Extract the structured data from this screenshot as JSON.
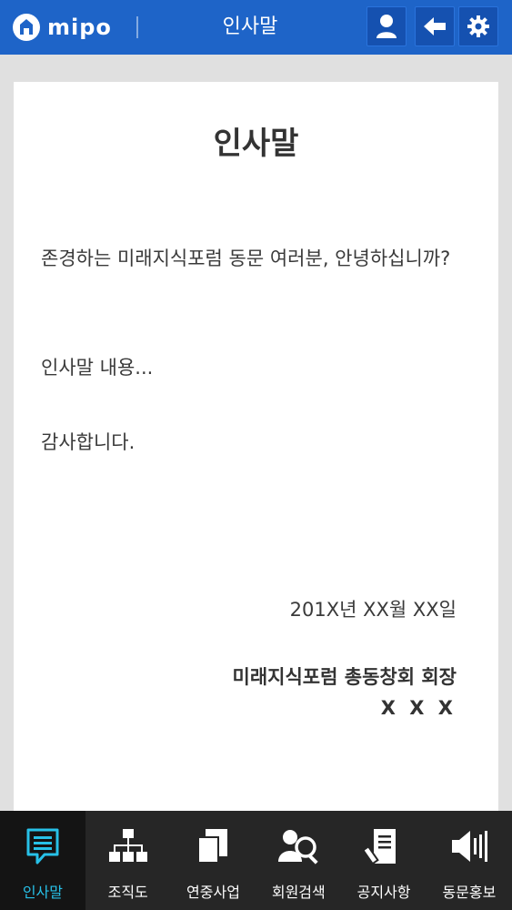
{
  "header": {
    "logo_text": "mipo",
    "title": "인사말",
    "buttons": [
      {
        "name": "user",
        "icon": "user-icon"
      },
      {
        "name": "back",
        "icon": "back-arrow-icon"
      },
      {
        "name": "settings",
        "icon": "gear-icon"
      }
    ]
  },
  "content": {
    "title": "인사말",
    "greeting": "존경하는 미래지식포럼 동문 여러분, 안녕하십니까?",
    "body": "인사말 내용...",
    "closing": "감사합니다.",
    "date": "201X년 XX월 XX일",
    "signer_title": "미래지식포럼 총동창회 회장",
    "signer_name": "X X X"
  },
  "nav": {
    "items": [
      {
        "label": "인사말",
        "icon": "speech-bubble-icon",
        "active": true
      },
      {
        "label": "조직도",
        "icon": "org-chart-icon",
        "active": false
      },
      {
        "label": "연중사업",
        "icon": "pages-icon",
        "active": false
      },
      {
        "label": "회원검색",
        "icon": "member-search-icon",
        "active": false
      },
      {
        "label": "공지사항",
        "icon": "notice-document-icon",
        "active": false
      },
      {
        "label": "동문홍보",
        "icon": "speaker-icon",
        "active": false
      }
    ]
  },
  "colors": {
    "header_bg": "#1e64c8",
    "nav_bg": "#262626",
    "nav_active_label": "#27c1e8",
    "page_bg": "#e0e0e0"
  }
}
